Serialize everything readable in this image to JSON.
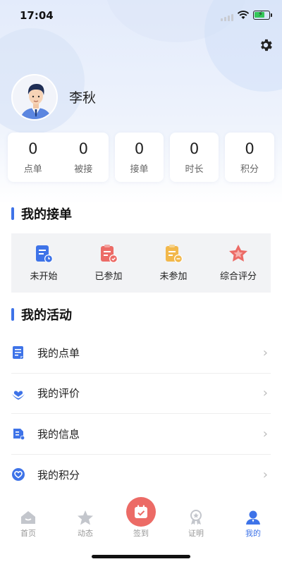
{
  "status_bar": {
    "time": "17:04"
  },
  "profile": {
    "name": "李秋"
  },
  "stats_cards": [
    {
      "items": [
        {
          "value": "0",
          "label": "点单"
        },
        {
          "value": "0",
          "label": "被接"
        }
      ]
    },
    {
      "items": [
        {
          "value": "0",
          "label": "接单"
        }
      ]
    },
    {
      "items": [
        {
          "value": "0",
          "label": "时长"
        }
      ]
    },
    {
      "items": [
        {
          "value": "0",
          "label": "积分"
        }
      ]
    }
  ],
  "my_orders": {
    "title": "我的接单",
    "items": [
      {
        "label": "未开始",
        "icon": "calendar-clock-icon",
        "color": "#3e73e8"
      },
      {
        "label": "已参加",
        "icon": "clipboard-check-icon",
        "color": "#ec6b66"
      },
      {
        "label": "未参加",
        "icon": "clipboard-minus-icon",
        "color": "#f2b84b"
      },
      {
        "label": "综合评分",
        "icon": "star-badge-icon",
        "color": "#ec6b66"
      }
    ]
  },
  "my_activities": {
    "title": "我的活动",
    "items": [
      {
        "label": "我的点单",
        "icon": "document-icon"
      },
      {
        "label": "我的评价",
        "icon": "heart-hands-icon"
      },
      {
        "label": "我的信息",
        "icon": "info-card-icon"
      },
      {
        "label": "我的积分",
        "icon": "heart-circle-icon"
      }
    ]
  },
  "tab_bar": {
    "items": [
      {
        "label": "首页",
        "icon": "home-icon",
        "active": false
      },
      {
        "label": "动态",
        "icon": "star-icon",
        "active": false
      },
      {
        "label": "签到",
        "icon": "calendar-check-icon",
        "active": false
      },
      {
        "label": "证明",
        "icon": "award-icon",
        "active": false
      },
      {
        "label": "我的",
        "icon": "user-icon",
        "active": true
      }
    ]
  },
  "colors": {
    "accent": "#3e73e8",
    "red": "#ec6b66",
    "yellow": "#f2b84b",
    "inactive": "#999999"
  }
}
